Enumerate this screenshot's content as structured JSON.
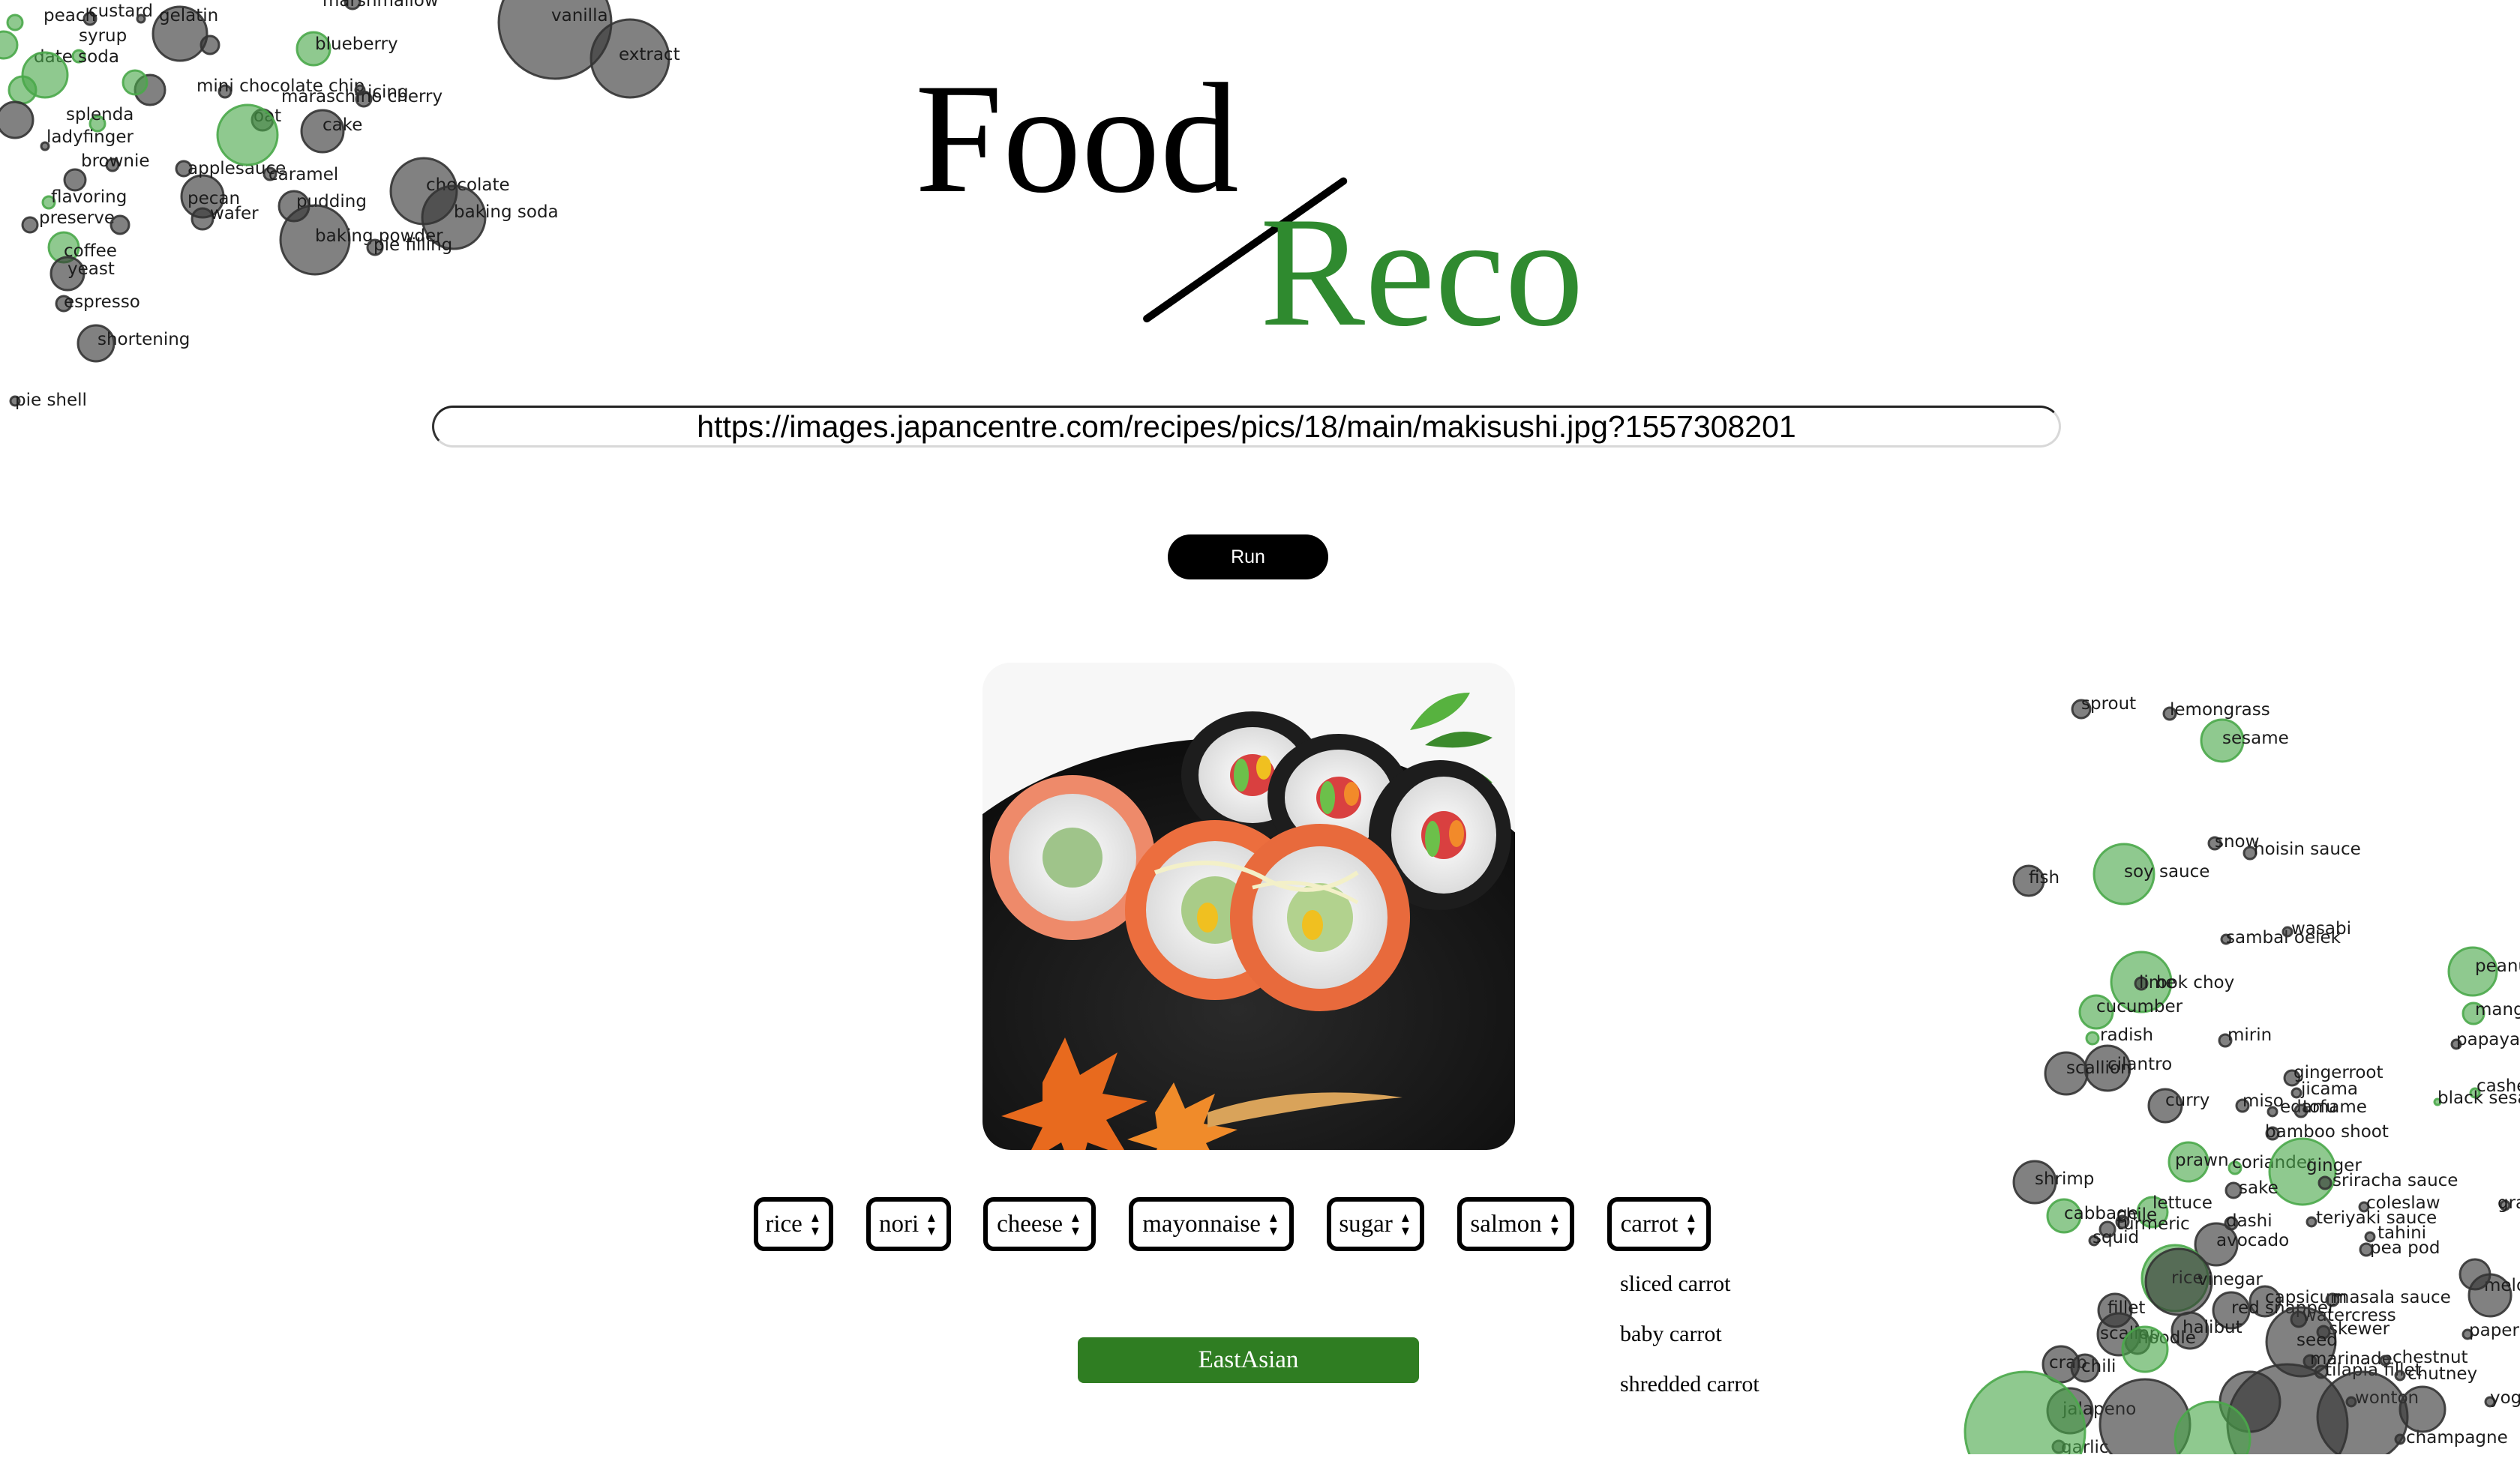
{
  "logo": {
    "word1": "Food",
    "word2": "Reco"
  },
  "search": {
    "url_value": "https://images.japancentre.com/recipes/pics/18/main/makisushi.jpg?1557308201"
  },
  "run_button": {
    "label": "Run"
  },
  "image": {
    "subject": "sushi rolls on a black lacquer plate"
  },
  "ingredients": [
    {
      "selected": "rice"
    },
    {
      "selected": "nori"
    },
    {
      "selected": "cheese"
    },
    {
      "selected": "mayonnaise"
    },
    {
      "selected": "sugar"
    },
    {
      "selected": "salmon"
    },
    {
      "selected": "carrot"
    }
  ],
  "dropdown_options": [
    "sliced carrot",
    "baby carrot",
    "shredded carrot"
  ],
  "cuisine": {
    "label": "EastAsian"
  },
  "colors": {
    "brand_green": "#2f8a2f",
    "cuisine_badge": "#2f7d22",
    "bubble_green": "#4aa84a",
    "bubble_dark": "#333333"
  },
  "bubble_words_top_left": [
    "marshmallow",
    "vanilla",
    "extract",
    "custard",
    "peach",
    "syrup",
    "gelatin",
    "blueberry",
    "date soda",
    "mini chocolate chip",
    "maraschino cherry",
    "splenda",
    "oat",
    "cake",
    "ladyfinger",
    "brownie",
    "caramel",
    "chocolate",
    "baking soda",
    "pecan",
    "wafer",
    "pudding",
    "baking powder",
    "pie filling",
    "flavoring",
    "preserve",
    "coffee",
    "yeast",
    "espresso",
    "shortening",
    "pie shell",
    "applesauce",
    "icing"
  ],
  "bubble_words_bottom_right": [
    "sprout",
    "lemongrass",
    "sesame",
    "snow",
    "hoisin sauce",
    "fish",
    "soy sauce",
    "sambal oelek",
    "wasabi",
    "bok choy",
    "lime",
    "cucumber",
    "radish",
    "mirin",
    "peanut",
    "mango",
    "papaya",
    "cilantro",
    "scallion",
    "gingerroot",
    "curry",
    "jicama",
    "miso",
    "edamame",
    "cashew",
    "black sesame",
    "tofu",
    "bamboo shoot",
    "coriander",
    "prawn",
    "ginger",
    "sriracha sauce",
    "shrimp",
    "sake",
    "coleslaw",
    "lettuce",
    "cabbage",
    "chile",
    "dashi",
    "teriyaki sauce",
    "tahini",
    "turmeric",
    "squid",
    "avocado",
    "pea pod",
    "rice",
    "vinegar",
    "capsicum",
    "masala sauce",
    "red snapper",
    "watercress",
    "fillet",
    "halibut",
    "noodle",
    "skewer",
    "scallop",
    "seed",
    "marinade",
    "crab",
    "chili",
    "tilapia fillet",
    "chestnut",
    "chutney",
    "jalapeno",
    "wonton",
    "champagne",
    "garlic",
    "yogurt",
    "paper",
    "melon",
    "grape"
  ]
}
